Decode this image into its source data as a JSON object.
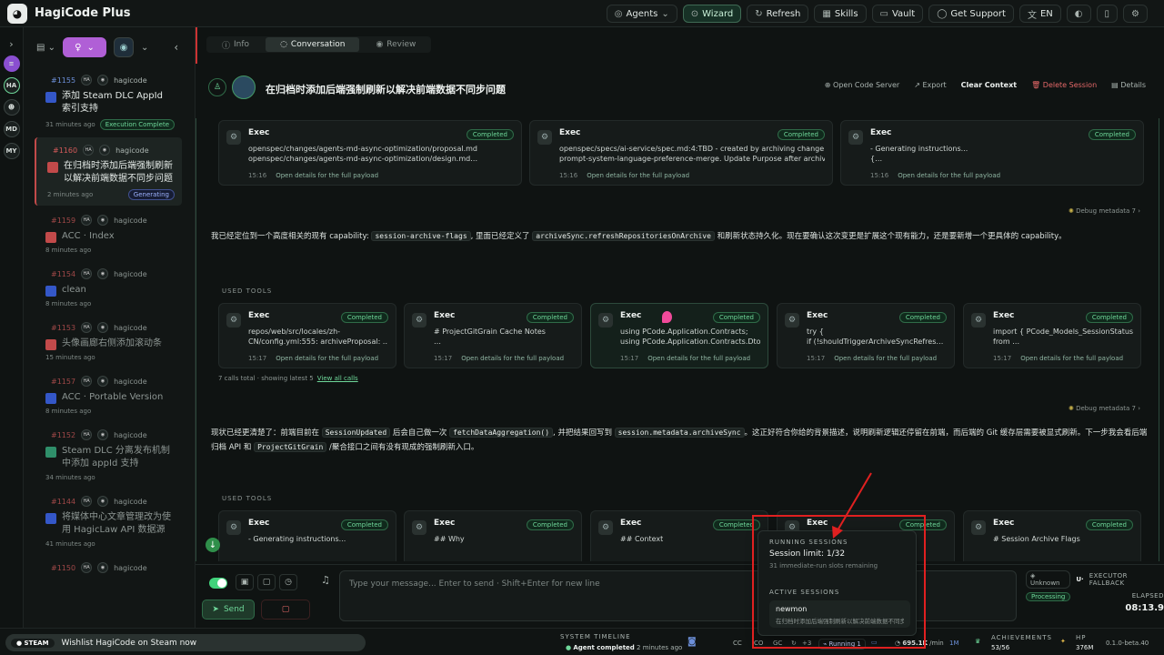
{
  "app": {
    "title": "HagiCode Plus"
  },
  "topnav": [
    "Agents",
    "Wizard",
    "Refresh",
    "Skills",
    "Vault",
    "Get Support",
    "EN"
  ],
  "rail": [
    "HA",
    "MD",
    "MY"
  ],
  "sidebar": {
    "sessions": [
      {
        "num": "#1155",
        "user": "hagicode",
        "title": "添加 Steam DLC AppId 索引支持",
        "time": "31 minutes ago",
        "badge": "Execution Complete"
      },
      {
        "num": "#1160",
        "user": "hagicode",
        "title": "在归档时添加后端强制刷新以解决前端数据不同步问题",
        "time": "2 minutes ago",
        "badge": "Generating"
      },
      {
        "num": "#1159",
        "user": "hagicode",
        "title": "ACC · Index",
        "time": "8 minutes ago"
      },
      {
        "num": "#1154",
        "user": "hagicode",
        "title": "clean",
        "time": "8 minutes ago"
      },
      {
        "num": "#1153",
        "user": "hagicode",
        "title": "头像画廊右侧添加滚动条",
        "time": "15 minutes ago"
      },
      {
        "num": "#1157",
        "user": "hagicode",
        "title": "ACC · Portable Version",
        "time": "8 minutes ago"
      },
      {
        "num": "#1152",
        "user": "hagicode",
        "title": "Steam DLC 分离发布机制中添加 appId 支持",
        "time": "34 minutes ago"
      },
      {
        "num": "#1144",
        "user": "hagicode",
        "title": "将媒体中心文章管理改为使用 HagicLaw API 数据源",
        "time": "41 minutes ago"
      },
      {
        "num": "#1150",
        "user": "hagicode",
        "title": "",
        "time": ""
      }
    ]
  },
  "main": {
    "tabs": [
      "Info",
      "Conversation",
      "Review"
    ],
    "session_title": "在归档时添加后端强制刷新以解决前端数据不同步问题",
    "actions": [
      "Open Code Server",
      "Export",
      "Clear Context",
      "Delete Session",
      "Details"
    ],
    "top_cards": [
      {
        "title": "Exec",
        "status": "Completed",
        "l1": "openspec/changes/agents-md-async-optimization/proposal.md",
        "l2": "openspec/changes/agents-md-async-optimization/design.md…",
        "time": "15:16",
        "link": "Open details for the full payload"
      },
      {
        "title": "Exec",
        "status": "Completed",
        "l1": "openspec/specs/ai-service/spec.md:4:TBD - created by archiving change",
        "l2": "prompt-system-language-preference-merge. Update Purpose after archive.…",
        "time": "15:16",
        "link": "Open details for the full payload"
      },
      {
        "title": "Exec",
        "status": "Completed",
        "l1": "- Generating instructions...",
        "l2": "{…",
        "time": "15:16",
        "link": "Open details for the full payload"
      }
    ],
    "debug_label": "Debug metadata",
    "debug_count": "7",
    "para1_a": "我已经定位到一个高度相关的现有 capability:",
    "para1_code1": "session-archive-flags",
    "para1_b": ", 里面已经定义了",
    "para1_code2": "archiveSync.refreshRepositoriesOnArchive",
    "para1_c": "和刷新状态持久化。现在要确认这次变更是扩展这个现有能力，还是要新增一个更具体的 capability。",
    "used_tools": "USED TOOLS",
    "mid_cards": [
      {
        "title": "Exec",
        "status": "Completed",
        "l1": "repos/web/src/locales/zh-",
        "l2": "CN/config.yml:555:   archiveProposal: …",
        "time": "15:17",
        "link": "Open details for the full payload"
      },
      {
        "title": "Exec",
        "status": "Completed",
        "l1": "# ProjectGitGrain Cache Notes",
        "l2": "…",
        "time": "15:17",
        "link": "Open details for the full payload"
      },
      {
        "title": "Exec",
        "status": "Completed",
        "l1": "using PCode.Application.Contracts;",
        "l2": "using PCode.Application.Contracts.Dto…",
        "time": "15:17",
        "link": "Open details for the full payload"
      },
      {
        "title": "Exec",
        "status": "Completed",
        "l1": "try {",
        "l2": "    if (!shouldTriggerArchiveSyncRefres…",
        "time": "15:17",
        "link": "Open details for the full payload"
      },
      {
        "title": "Exec",
        "status": "Completed",
        "l1": "import { PCode_Models_SessionStatus }",
        "l2": "from …",
        "time": "15:17",
        "link": "Open details for the full payload"
      }
    ],
    "calls_total": "7 calls total · showing latest 5",
    "view_all": "View all calls",
    "para2_a": "现状已经更清楚了：前端目前在",
    "para2_code1": "SessionUpdated",
    "para2_b": "后会自己做一次",
    "para2_code2": "fetchDataAggregation()",
    "para2_c": ", 并把结果回写到",
    "para2_code3": "session.metadata.archiveSync",
    "para2_d": "。这正好符合你给的背景描述，说明刷新逻辑还停留在前端，而后端的 Git 缓存层需要被显式刷新。下一步我会看后端归档 API 和",
    "para2_code4": "ProjectGitGrain",
    "para2_e": "/聚合接口之间有没有现成的强制刷新入口。",
    "bottom_cards": [
      {
        "title": "Exec",
        "status": "Completed",
        "l1": "- Generating instructions..."
      },
      {
        "title": "Exec",
        "status": "Completed",
        "l1": "## Why"
      },
      {
        "title": "Exec",
        "status": "Completed",
        "l1": "## Context"
      },
      {
        "title": "Exec",
        "status": "Completed",
        "l1": ""
      },
      {
        "title": "Exec",
        "status": "Completed",
        "l1": "# Session Archive Flags"
      }
    ]
  },
  "input": {
    "placeholder": "Type your message... Enter to send  ·  Shift+Enter for new line",
    "send": "Send",
    "exec_unknown": "Unknown",
    "exec_u": "U·",
    "exec_label": "EXECUTOR FALLBACK",
    "processing": "Processing",
    "elapsed_label": "ELAPSED",
    "elapsed": "08:13.9"
  },
  "popup": {
    "h1": "RUNNING SESSIONS",
    "limit": "Session limit: 1/32",
    "remaining": "31 immediate-run slots remaining",
    "h2": "ACTIVE SESSIONS",
    "item_name": "newmon",
    "item_desc": "在归档时添加后端强制刷新以解决前端数据不同步问题…"
  },
  "status": {
    "steam_badge": "STEAM",
    "steam_text": "Wishlist HagiCode on Steam now",
    "timeline_label": "SYSTEM TIMELINE",
    "timeline_event": "Agent completed",
    "timeline_time": "2 minutes ago",
    "running": "Running 1",
    "plus": "+3",
    "tokens": "695.1K",
    "per": "/min",
    "cost": "1M",
    "achievements_label": "ACHIEVEMENTS",
    "achievements": "53/56",
    "hp_label": "HP",
    "hp": "376M",
    "version": "0.1.0-beta.40"
  },
  "colors": {
    "accent": "#41d37b",
    "danger": "#e46868",
    "purple": "#b05fd6",
    "annotation": "#e02020"
  }
}
